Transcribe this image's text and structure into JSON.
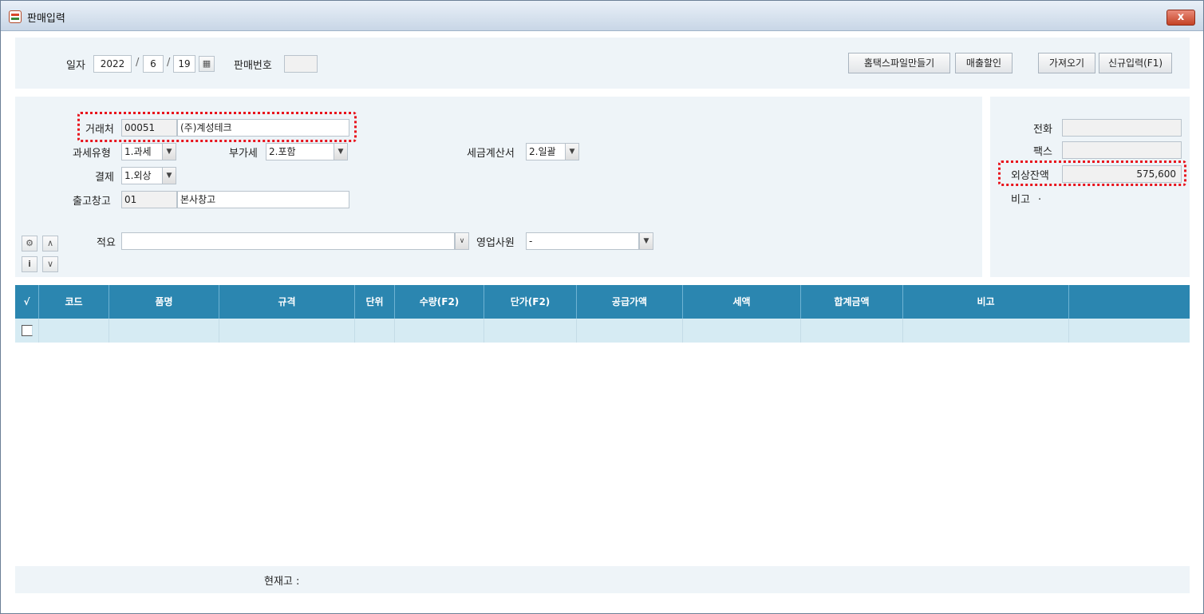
{
  "window": {
    "title": "판매입력",
    "close_label": "x"
  },
  "header": {
    "date_label": "일자",
    "year": "2022",
    "month": "6",
    "day": "19",
    "date_sep": "/",
    "sale_no_label": "판매번호",
    "sale_no": "",
    "buttons": {
      "hometax": "홈택스파일만들기",
      "discount": "매출할인",
      "fetch": "가져오기",
      "new": "신규입력(F1)"
    }
  },
  "form": {
    "client_label": "거래처",
    "client_code": "00051",
    "client_name": "(주)계성테크",
    "tax_type_label": "과세유형",
    "tax_type": "1.과세",
    "vat_label": "부가세",
    "vat": "2.포함",
    "invoice_label": "세금계산서",
    "invoice": "2.일괄",
    "payment_label": "결제",
    "payment": "1.외상",
    "warehouse_label": "출고창고",
    "warehouse_code": "01",
    "warehouse_name": "본사창고",
    "memo_label": "적요",
    "memo": "",
    "sales_rep_label": "영업사원",
    "sales_rep": "-"
  },
  "side": {
    "phone_label": "전화",
    "phone": "",
    "fax_label": "팩스",
    "fax": "",
    "receivable_label": "외상잔액",
    "receivable": "575,600",
    "note_label": "비고",
    "note": "."
  },
  "table": {
    "columns": [
      "√",
      "코드",
      "품명",
      "규격",
      "단위",
      "수량(F2)",
      "단가(F2)",
      "공급가액",
      "세액",
      "합계금액",
      "비고",
      ""
    ]
  },
  "footer": {
    "stock_label": "현재고 :"
  }
}
